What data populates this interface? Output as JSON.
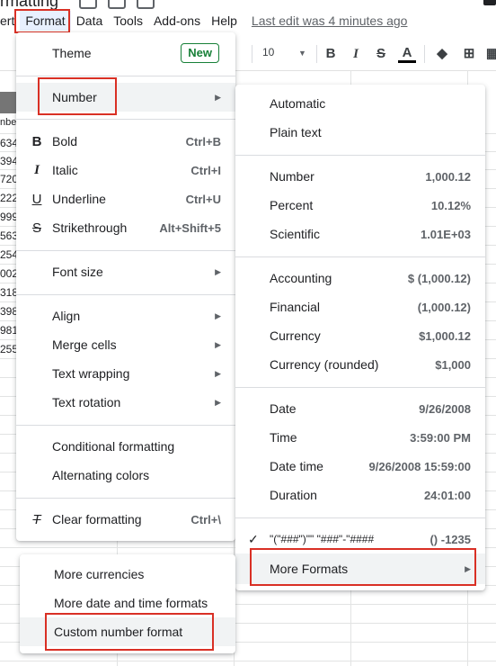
{
  "doc": {
    "title_fragment": "rmatting"
  },
  "menubar": {
    "items": [
      "ert",
      "Format",
      "Data",
      "Tools",
      "Add-ons",
      "Help"
    ],
    "last_edit": "Last edit was 4 minutes ago"
  },
  "toolbar": {
    "font_size": "10"
  },
  "sheet": {
    "column_head_fragment": "nbe",
    "cell_values": [
      "634",
      "394",
      "720",
      "222",
      "999",
      "563",
      "254",
      "002",
      "318",
      "398",
      "981",
      "255"
    ]
  },
  "format_menu": {
    "theme": {
      "label": "Theme",
      "badge": "New"
    },
    "number": {
      "label": "Number"
    },
    "bold": {
      "label": "Bold",
      "shortcut": "Ctrl+B",
      "icon": "bold-icon"
    },
    "italic": {
      "label": "Italic",
      "shortcut": "Ctrl+I",
      "icon": "italic-icon"
    },
    "underline": {
      "label": "Underline",
      "shortcut": "Ctrl+U",
      "icon": "underline-icon"
    },
    "strikethrough": {
      "label": "Strikethrough",
      "shortcut": "Alt+Shift+5",
      "icon": "strikethrough-icon"
    },
    "font_size": {
      "label": "Font size"
    },
    "align": {
      "label": "Align"
    },
    "merge_cells": {
      "label": "Merge cells"
    },
    "text_wrapping": {
      "label": "Text wrapping"
    },
    "text_rotation": {
      "label": "Text rotation"
    },
    "conditional_formatting": {
      "label": "Conditional formatting"
    },
    "alternating_colors": {
      "label": "Alternating colors"
    },
    "clear_formatting": {
      "label": "Clear formatting",
      "shortcut": "Ctrl+\\",
      "icon": "clear-formatting-icon"
    }
  },
  "number_menu": {
    "automatic": "Automatic",
    "plain_text": "Plain text",
    "formats": [
      {
        "label": "Number",
        "sample": "1,000.12"
      },
      {
        "label": "Percent",
        "sample": "10.12%"
      },
      {
        "label": "Scientific",
        "sample": "1.01E+03"
      },
      {
        "label": "Accounting",
        "sample": "$ (1,000.12)"
      },
      {
        "label": "Financial",
        "sample": "(1,000.12)"
      },
      {
        "label": "Currency",
        "sample": "$1,000.12"
      },
      {
        "label": "Currency (rounded)",
        "sample": "$1,000"
      },
      {
        "label": "Date",
        "sample": "9/26/2008"
      },
      {
        "label": "Time",
        "sample": "3:59:00 PM"
      },
      {
        "label": "Date time",
        "sample": "9/26/2008 15:59:00"
      },
      {
        "label": "Duration",
        "sample": "24:01:00"
      }
    ],
    "custom_recent": {
      "label": "\"(\"###\")\"\" \"###\"-\"####",
      "sample": "() -1235"
    },
    "more_formats": "More Formats"
  },
  "more_formats_menu": {
    "items": [
      "More currencies",
      "More date and time formats",
      "Custom number format"
    ]
  },
  "colors": {
    "highlight_red": "#d93025",
    "new_badge_green": "#188038"
  }
}
